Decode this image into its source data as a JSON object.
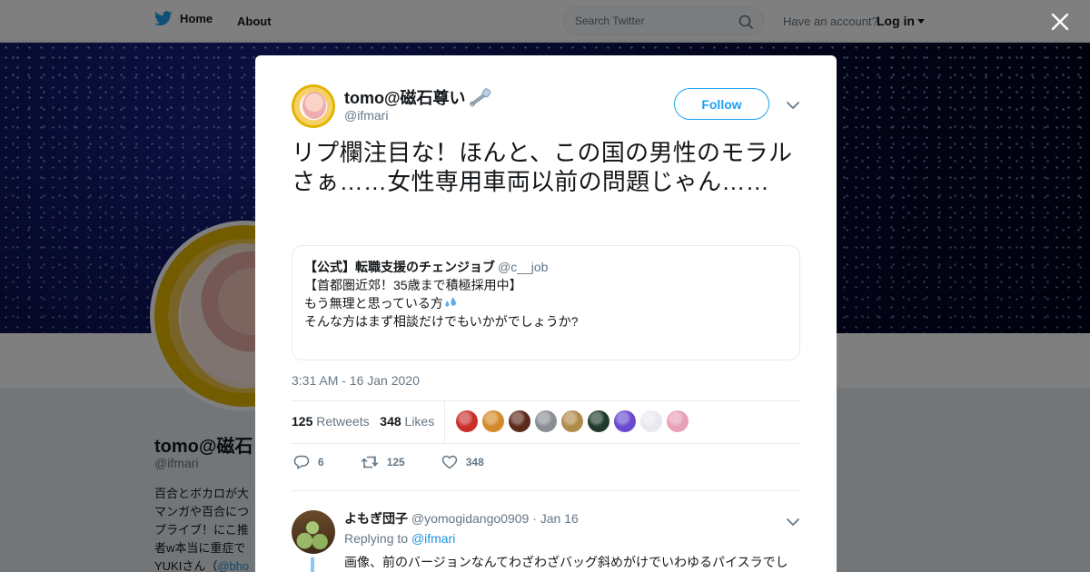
{
  "topbar": {
    "home_label": "Home",
    "about_label": "About",
    "search_placeholder": "Search Twitter",
    "have_account": "Have an account?",
    "login_label": "Log in"
  },
  "profile_bg": {
    "name": "tomo@磁石",
    "handle": "@ifmari",
    "bio_lines": [
      "百合とボカロが大",
      "マンガや百合につ",
      "プライブ！にこ推",
      "者w本当に重症で"
    ],
    "bio_last_prefix": "YUKIさん（",
    "bio_last_link": "@bho"
  },
  "tweet": {
    "author_name": "tomo@磁石尊い",
    "author_handle": "@ifmari",
    "follow_label": "Follow",
    "text": "リプ欄注目な！ほんと、この国の男性のモラルさぁ……女性専用車両以前の問題じゃん……",
    "quote": {
      "name": "【公式】転職支援のチェンジョブ",
      "handle": "@c__job",
      "line1": "【首都圏近郊！35歳まで積極採用中】",
      "line2": "もう無理と思っている方",
      "line3": "そんな方はまず相談だけでもいかがでしょうか?"
    },
    "timestamp": "3:31 AM - 16 Jan 2020",
    "retweets_count": "125",
    "retweets_label": "Retweets",
    "likes_count": "348",
    "likes_label": "Likes",
    "liker_colors": [
      "#c9302c",
      "#d4892a",
      "#5a2a1a",
      "#8a8f96",
      "#b08a4a",
      "#1f3a2a",
      "#6a4ad0",
      "#e8e8f0",
      "#e8a0b8"
    ],
    "action_replies": "6",
    "action_retweets": "125",
    "action_likes": "348"
  },
  "reply": {
    "name": "よもぎ団子",
    "handle": "@yomogidango0909",
    "date": "Jan 16",
    "replying_to_label": "Replying to",
    "replying_to_handle": "@ifmari",
    "text": "画像、前のバージョンなんてわざわざバッグ斜めがけでいわゆるパイスラでし"
  },
  "colors": {
    "accent": "#1da1f2",
    "link": "#1b95e0",
    "muted": "#657786"
  }
}
